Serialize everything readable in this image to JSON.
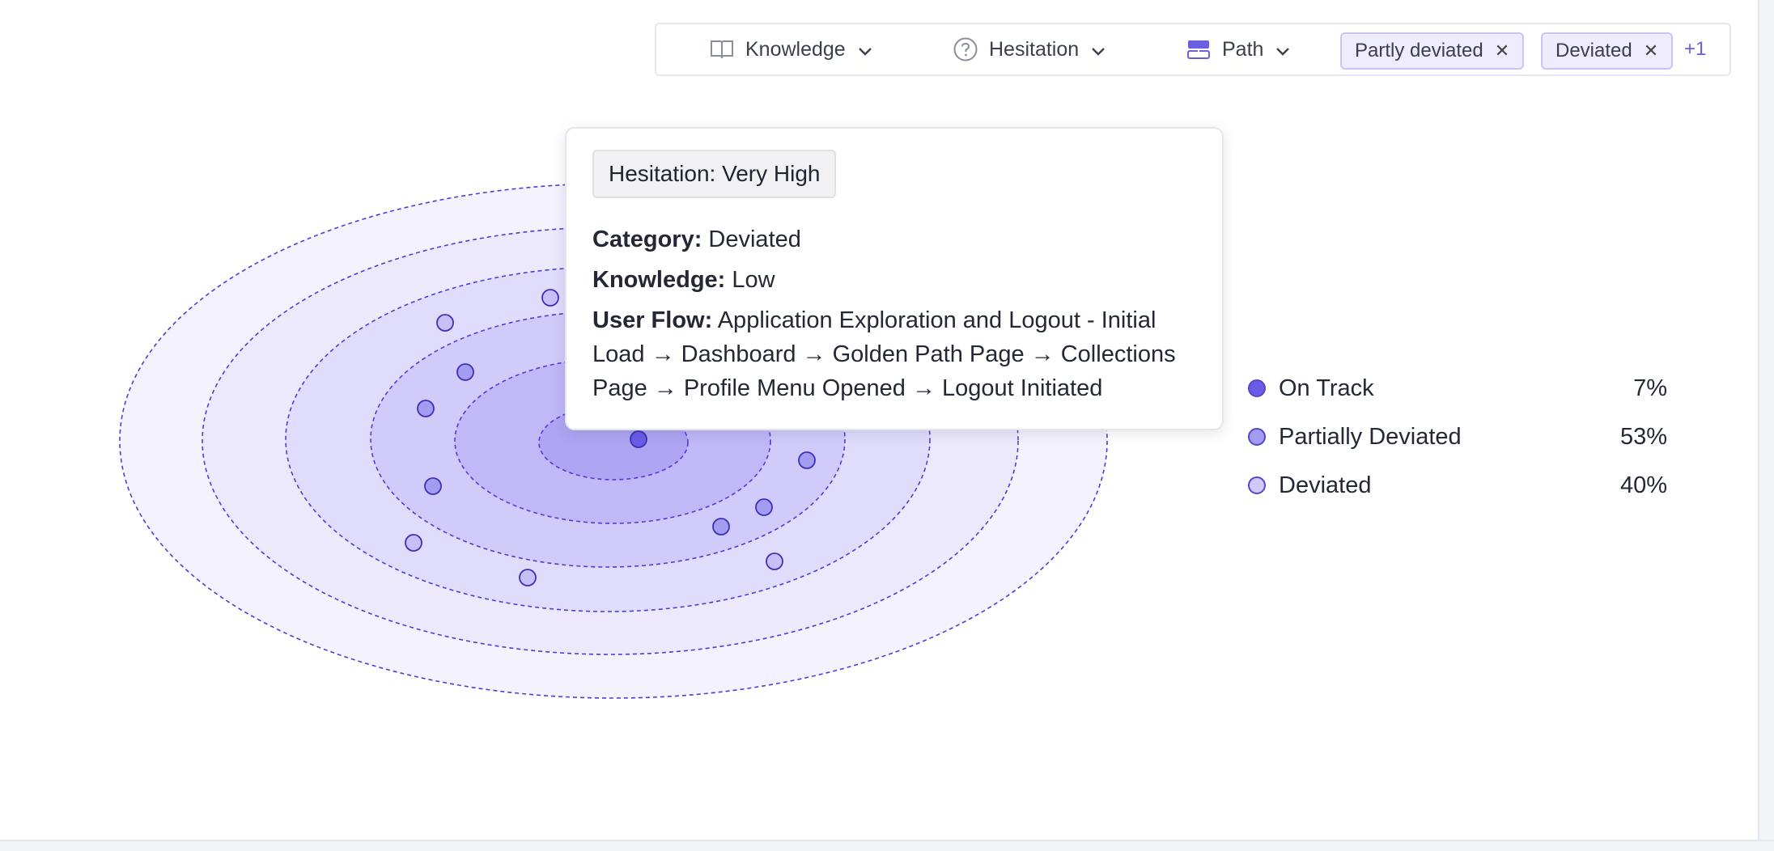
{
  "filters": {
    "knowledge_label": "Knowledge",
    "hesitation_label": "Hesitation",
    "path_label": "Path",
    "chips": [
      "Partly deviated",
      "Deviated"
    ],
    "more_label": "+1"
  },
  "tooltip": {
    "badge": "Hesitation: Very High",
    "category_label": "Category:",
    "category_value": "Deviated",
    "knowledge_label": "Knowledge:",
    "knowledge_value": "Low",
    "flow_label": "User Flow:",
    "flow_value": "Application Exploration and Logout - Initial Load → Dashboard → Golden Path Page → Collections Page → Profile Menu Opened → Logout Initiated"
  },
  "legend": {
    "items": [
      {
        "label": "On Track",
        "value": "7%",
        "color": "#6b5ce7"
      },
      {
        "label": "Partially Deviated",
        "value": "53%",
        "color": "#a49cf0"
      },
      {
        "label": "Deviated",
        "value": "40%",
        "color": "#cfc9f8"
      }
    ]
  },
  "colors": {
    "accent": "#6a5fe0",
    "ring_stroke": "#4b3fd9",
    "chip_bg": "#efedfd"
  }
}
